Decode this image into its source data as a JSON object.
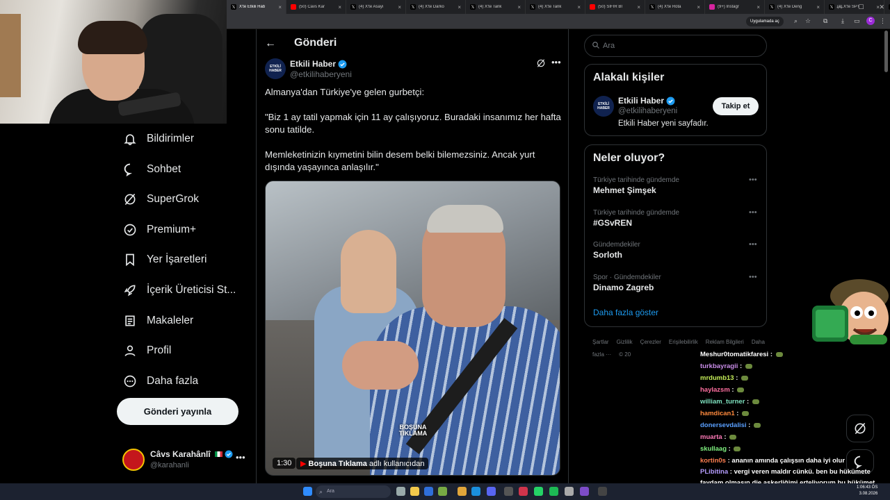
{
  "browser": {
    "tabs": [
      {
        "label": "X'te Etkili Hab",
        "fav": "x",
        "active": true
      },
      {
        "label": "(50) Cavs Kar",
        "fav": "yt"
      },
      {
        "label": "(4) X'te Asayi",
        "fav": "x"
      },
      {
        "label": "(4) X'te Darko",
        "fav": "x"
      },
      {
        "label": "(4) X'te Tank",
        "fav": "x"
      },
      {
        "label": "(4) X'te Tank",
        "fav": "x"
      },
      {
        "label": "(50) SIFIR Bİ",
        "fav": "yt"
      },
      {
        "label": "(4) X'te Rota",
        "fav": "x"
      },
      {
        "label": "(9+) Instagr",
        "fav": "ig"
      },
      {
        "label": "(4) X'te Deng",
        "fav": "x"
      },
      {
        "label": "(4) X'te SPT",
        "fav": "x"
      },
      {
        "label": "(4) X'te Mor",
        "fav": "x"
      }
    ],
    "app_button": "Uygulamada aç",
    "profile_initial": "C"
  },
  "nav": {
    "items": [
      {
        "label": "Bildirimler",
        "icon": "bell-icon"
      },
      {
        "label": "Sohbet",
        "icon": "chat-icon"
      },
      {
        "label": "SuperGrok",
        "icon": "grok-icon"
      },
      {
        "label": "Premium+",
        "icon": "verified-icon"
      },
      {
        "label": "Yer İşaretleri",
        "icon": "bookmark-icon"
      },
      {
        "label": "İçerik Üreticisi St...",
        "icon": "rocket-icon"
      },
      {
        "label": "Makaleler",
        "icon": "article-icon"
      },
      {
        "label": "Profil",
        "icon": "profile-icon"
      },
      {
        "label": "Daha fazla",
        "icon": "more-circle-icon"
      }
    ],
    "post_button": "Gönderi yayınla",
    "account": {
      "name": "Câvs Karahânlî",
      "handle": "@karahanli"
    }
  },
  "post": {
    "header_title": "Gönderi",
    "author_name": "Etkili Haber",
    "author_handle": "@etkilihaberyeni",
    "avatar_text": "ETKİLİ HABER",
    "paragraphs": [
      "Almanya'dan Türkiye'ye gelen gurbetçi:",
      "\"Biz 1 ay tatil yapmak için 11 ay çalışıyoruz. Buradaki insanımız her hafta sonu tatilde.",
      "Memleketinizin kıymetini bilin desem belki bilemezsiniz. Ancak yurt dışında yaşayınca anlaşılır.\""
    ],
    "video": {
      "duration": "1:30",
      "source_name": "Boşuna Tıklama",
      "source_suffix": "adlı kullanıcıdan",
      "watermark": "BOŞUNA TIKLAMA"
    }
  },
  "right": {
    "search_placeholder": "Ara",
    "relevant": {
      "title": "Alakalı kişiler",
      "name": "Etkili Haber",
      "handle": "@etkilihaberyeni",
      "bio": "Etkili Haber yeni sayfadır.",
      "follow_label": "Takip et"
    },
    "trends": {
      "title": "Neler oluyor?",
      "items": [
        {
          "context": "Türkiye tarihinde gündemde",
          "topic": "Mehmet Şimşek"
        },
        {
          "context": "Türkiye tarihinde gündemde",
          "topic": "#GSvREN"
        },
        {
          "context": "Gündemdekiler",
          "topic": "Sorloth"
        },
        {
          "context": "Spor · Gündemdekiler",
          "topic": "Dinamo Zagreb"
        }
      ],
      "show_more": "Daha fazla göster"
    },
    "footer": {
      "links": [
        "Şartlar",
        "Gizlilik",
        "Çerezler",
        "Erişilebilirlik",
        "Reklam Bilgileri",
        "Daha fazla ···"
      ],
      "copyright": "© 20"
    }
  },
  "chat": {
    "messages": [
      {
        "user": "Meshur0tomatikfaresi",
        "color": "#ffffff",
        "text": ""
      },
      {
        "user": "turkbayragii",
        "color": "#c98ce8",
        "text": ""
      },
      {
        "user": "mrdumb13",
        "color": "#c7f05a",
        "text": ""
      },
      {
        "user": "haylazsm",
        "color": "#ff6fa0",
        "text": ""
      },
      {
        "user": "william_turner",
        "color": "#7fe3c0",
        "text": ""
      },
      {
        "user": "hamdican1",
        "color": "#ff8a3d",
        "text": ""
      },
      {
        "user": "donersevdalisi",
        "color": "#5aa0ff",
        "text": ""
      },
      {
        "user": "muarta",
        "color": "#ff7ab8",
        "text": ""
      },
      {
        "user": "skullaag",
        "color": "#7ff07f",
        "text": ""
      },
      {
        "user": "kortin0s",
        "color": "#ff7f50",
        "text": "ananın amında çalışsın daha iyi olur"
      },
      {
        "user": "PLibitina",
        "color": "#b59cff",
        "text": "vergi veren maldır cünkü. ben bu hükümete faydam olmasın die askerliğimi erteliyorum bu hükümet gitsin sonra gitcem askere"
      }
    ]
  },
  "taskbar": {
    "search_placeholder": "Ara",
    "time": "1:06:43 ÖS",
    "date": "3.08.2026"
  },
  "colors": {
    "accent": "#1d9bf0",
    "verified": "#1d9bf0",
    "border": "#2f3336",
    "muted": "#71767b"
  }
}
